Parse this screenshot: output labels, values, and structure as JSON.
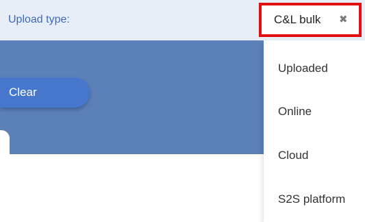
{
  "filter": {
    "label": "Upload type:",
    "selected": "C&L bulk",
    "remove_icon": "close-icon"
  },
  "actions": {
    "clear_label": "Clear"
  },
  "dropdown": {
    "options": [
      "Uploaded",
      "Online",
      "Cloud",
      "S2S platform"
    ]
  },
  "colors": {
    "filter_bar_bg": "#e8eef7",
    "label_text": "#3d6ab8",
    "panel_bg": "#5b81b8",
    "clear_button_bg": "#4677cc",
    "highlight_border": "#e01010"
  }
}
